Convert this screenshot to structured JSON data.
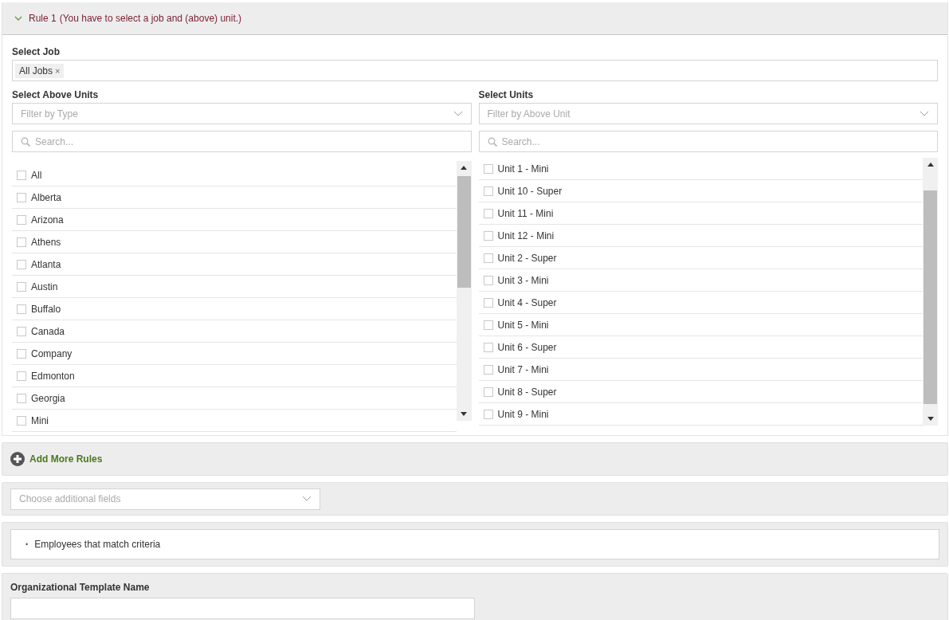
{
  "rule": {
    "title": "Rule 1",
    "note": "(You have to select a job and (above) unit.)",
    "expanded": true,
    "job": {
      "label": "Select Job",
      "tags": [
        "All Jobs"
      ],
      "remove": "×"
    },
    "above_units": {
      "label": "Select Above Units",
      "filter_placeholder": "Filter by Type",
      "search_placeholder": "Search...",
      "items": [
        {
          "label": "All",
          "checked": false
        },
        {
          "label": "Alberta",
          "checked": false
        },
        {
          "label": "Arizona",
          "checked": false
        },
        {
          "label": "Athens",
          "checked": false
        },
        {
          "label": "Atlanta",
          "checked": false
        },
        {
          "label": "Austin",
          "checked": false
        },
        {
          "label": "Buffalo",
          "checked": false
        },
        {
          "label": "Canada",
          "checked": false
        },
        {
          "label": "Company",
          "checked": false
        },
        {
          "label": "Edmonton",
          "checked": false
        },
        {
          "label": "Georgia",
          "checked": false
        },
        {
          "label": "Mini",
          "checked": false
        }
      ]
    },
    "units": {
      "label": "Select Units",
      "filter_placeholder": "Filter by Above Unit",
      "search_placeholder": "Search...",
      "items": [
        {
          "label": "Unit 1 - Mini",
          "checked": false
        },
        {
          "label": "Unit 10 - Super",
          "checked": false
        },
        {
          "label": "Unit 11 - Mini",
          "checked": false
        },
        {
          "label": "Unit 12 - Mini",
          "checked": false
        },
        {
          "label": "Unit 2 - Super",
          "checked": false
        },
        {
          "label": "Unit 3 - Mini",
          "checked": false
        },
        {
          "label": "Unit 4 - Super",
          "checked": false
        },
        {
          "label": "Unit 5 - Mini",
          "checked": false
        },
        {
          "label": "Unit 6 - Super",
          "checked": false
        },
        {
          "label": "Unit 7 - Mini",
          "checked": false
        },
        {
          "label": "Unit 8 - Super",
          "checked": false
        },
        {
          "label": "Unit 9 - Mini",
          "checked": false
        }
      ]
    }
  },
  "add_rules": {
    "label": "Add More Rules"
  },
  "additional_fields": {
    "placeholder": "Choose additional fields"
  },
  "summary": {
    "bullet": "•",
    "items": [
      "Employees that match criteria"
    ]
  },
  "template": {
    "label": "Organizational Template Name"
  }
}
